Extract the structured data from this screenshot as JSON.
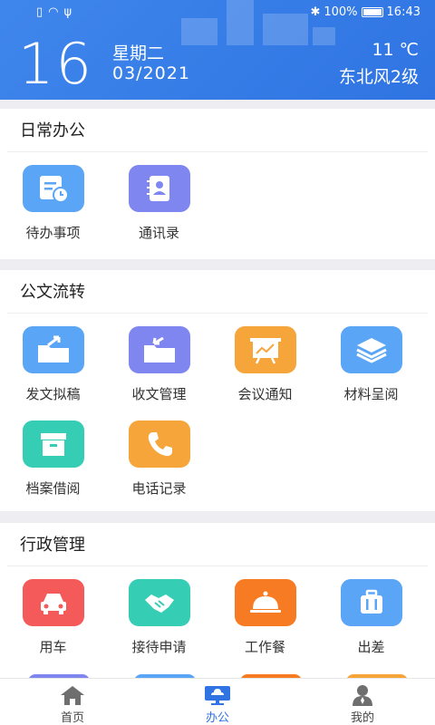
{
  "status_bar": {
    "battery": "100%",
    "time": "16:43"
  },
  "header": {
    "day": "16",
    "weekday": "星期二",
    "month_year": "03/2021",
    "temperature": "11 ℃",
    "wind": "东北风2级"
  },
  "sections": {
    "daily": {
      "title": "日常办公",
      "items": [
        "待办事项",
        "通讯录"
      ]
    },
    "docs": {
      "title": "公文流转",
      "items": [
        "发文拟稿",
        "收文管理",
        "会议通知",
        "材料呈阅",
        "档案借阅",
        "电话记录"
      ]
    },
    "admin": {
      "title": "行政管理",
      "items": [
        "用车",
        "接待申请",
        "工作餐",
        "出差"
      ]
    }
  },
  "tabs": [
    "首页",
    "办公",
    "我的"
  ],
  "colors": {
    "header_blue": "#2f74e2",
    "icon_blue": "#5aa5f5",
    "icon_purple": "#7f86ef",
    "icon_orange": "#f6a53a",
    "icon_teal": "#35cdb4",
    "icon_red": "#f55a5a",
    "icon_deep_orange": "#f77b22"
  }
}
